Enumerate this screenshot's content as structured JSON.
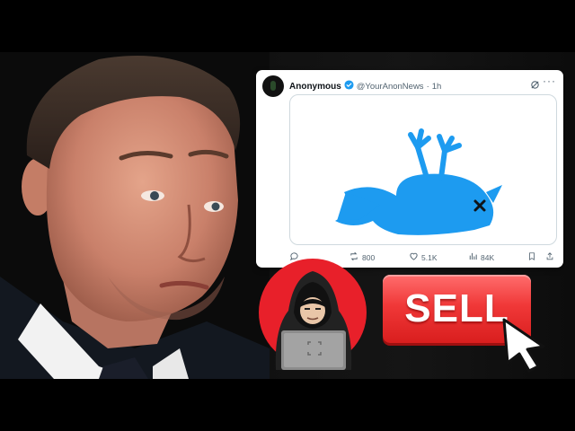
{
  "tweet": {
    "author_name": "Anonymous",
    "handle": "@YourAnonNews",
    "separator": "·",
    "time": "1h",
    "more_glyph": "···",
    "stats": {
      "retweets": "800",
      "likes": "5.1K",
      "views": "84K"
    }
  },
  "sell_button": {
    "label": "SELL"
  },
  "colors": {
    "twitter_blue": "#1d9bf0",
    "sell_red": "#f03838",
    "hacker_circle": "#e8202a"
  },
  "icons": [
    "verified-badge-icon",
    "grok-icon",
    "more-icon",
    "reply-icon",
    "retweet-icon",
    "like-icon",
    "views-icon",
    "bookmark-icon",
    "share-icon",
    "dead-bird-icon",
    "hacker-icon",
    "cursor-icon"
  ]
}
